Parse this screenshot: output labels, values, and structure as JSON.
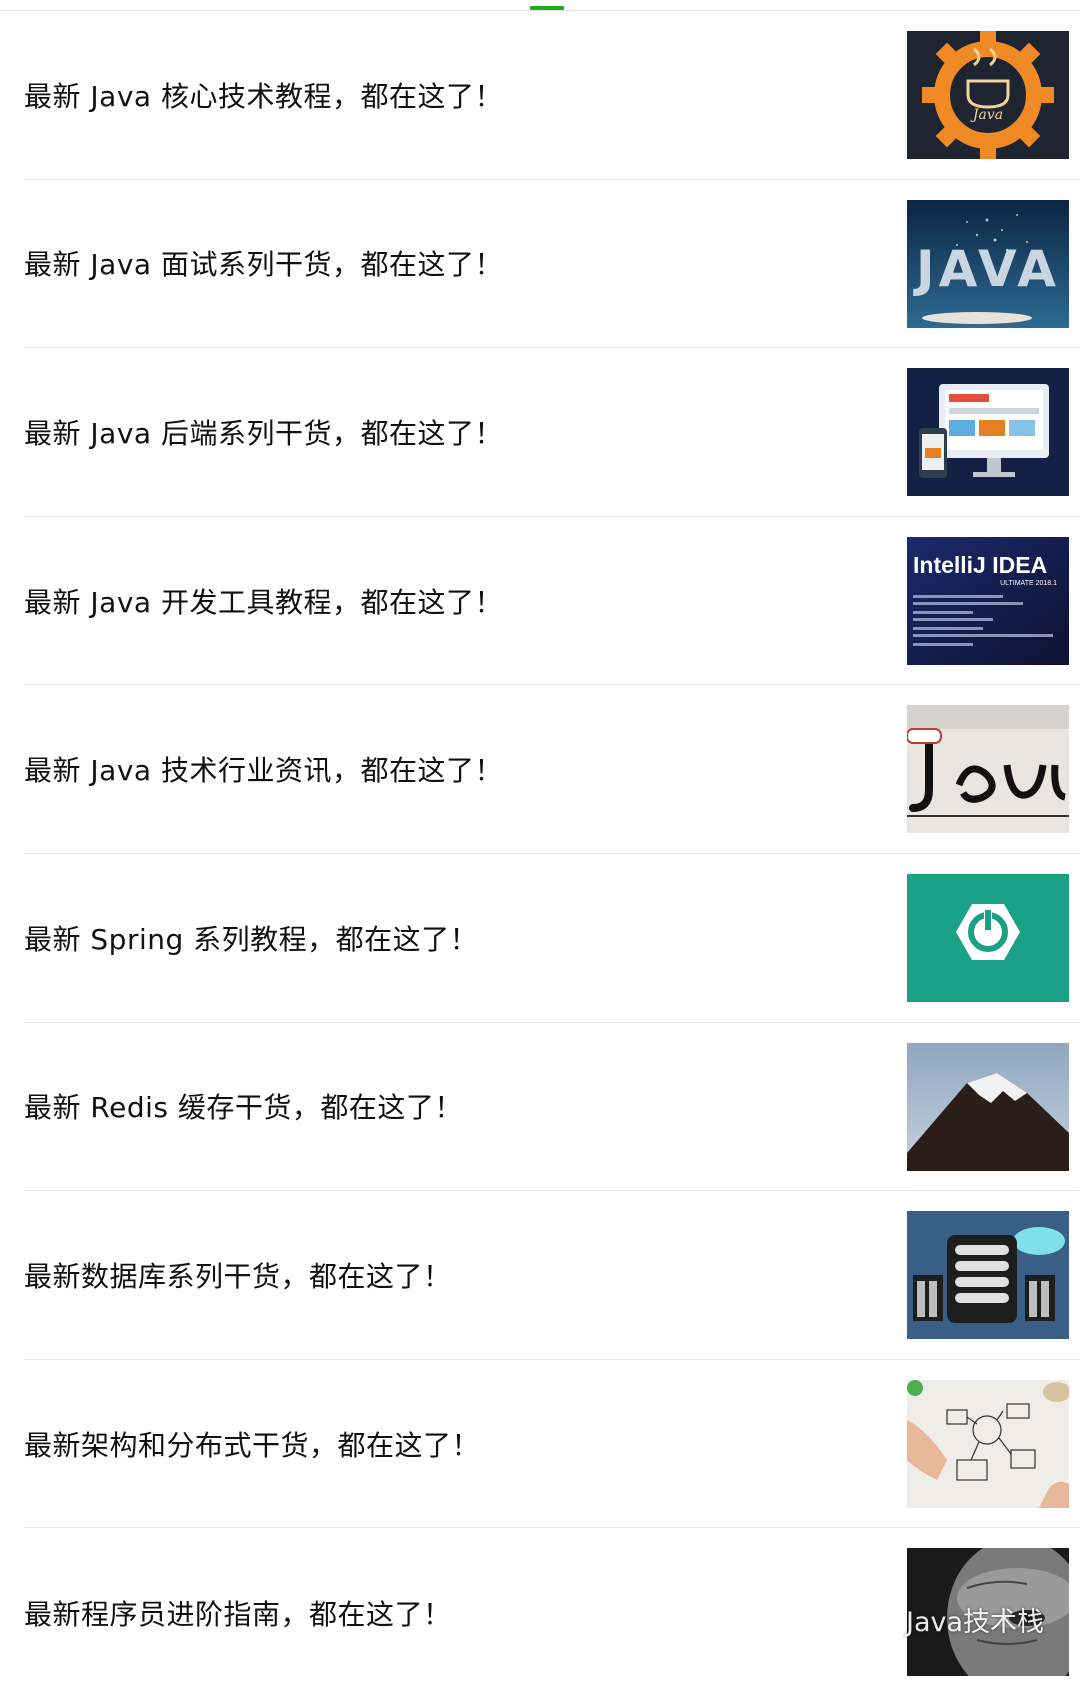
{
  "tab_indicator_color": "#1aad19",
  "articles": [
    {
      "title": "最新 Java 核心技术教程，都在这了！",
      "thumb": "java-gear-logo"
    },
    {
      "title": "最新 Java 面试系列干货，都在这了！",
      "thumb": "java-particles"
    },
    {
      "title": "最新 Java 后端系列干货，都在这了！",
      "thumb": "web-devices"
    },
    {
      "title": "最新 Java 开发工具教程，都在这了！",
      "thumb": "intellij-idea-splash"
    },
    {
      "title": "最新 Java 技术行业资讯，都在这了！",
      "thumb": "java-handwritten-sign"
    },
    {
      "title": "最新 Spring 系列教程，都在这了！",
      "thumb": "spring-boot-power-logo"
    },
    {
      "title": "最新 Redis 缓存干货，都在这了！",
      "thumb": "snowy-mountain"
    },
    {
      "title": "最新数据库系列干货，都在这了！",
      "thumb": "database-server-cloud"
    },
    {
      "title": "最新架构和分布式干货，都在这了！",
      "thumb": "architecture-sketch"
    },
    {
      "title": "最新程序员进阶指南，都在这了！",
      "thumb": "face-portrait"
    }
  ],
  "thumb_text": {
    "intellij_title": "IntelliJ IDEA",
    "intellij_edition": "ULTIMATE 2018.1",
    "java_logo_text": "Java",
    "java_big_text": "JAVA"
  },
  "watermark": {
    "text": "Java技术栈",
    "icon": "wechat-icon"
  }
}
